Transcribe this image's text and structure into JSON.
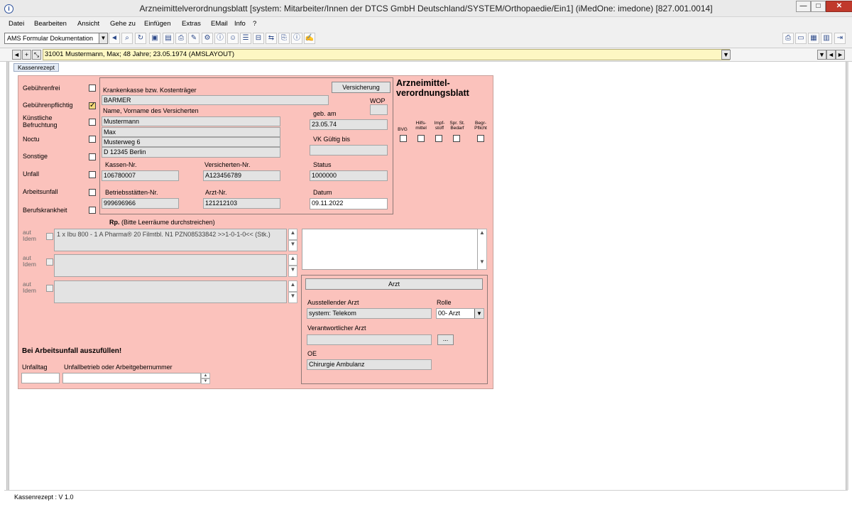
{
  "window": {
    "title": "Arzneimittelverordnungsblatt [system: Mitarbeiter/Innen der DTCS GmbH Deutschland/SYSTEM/Orthopaedie/Ein1] (iMedOne: imedone) [827.001.0014]",
    "minimize": "—",
    "maximize": "□",
    "close": "✕"
  },
  "menu": [
    "Datei",
    "Bearbeiten",
    "Ansicht",
    "Gehe zu",
    "Einfügen",
    "Extras",
    "EMail",
    "Info",
    "?"
  ],
  "toolbar": {
    "combo_value": "AMS Formular Dokumentation"
  },
  "patient": {
    "value": "31001 Mustermann, Max; 48 Jahre; 23.05.1974 (AMSLAYOUT)"
  },
  "tab": {
    "label": "Kassenrezept"
  },
  "left": {
    "items": [
      {
        "label": "Gebührenfrei",
        "checked": false
      },
      {
        "label": "Gebührenpflichtig",
        "checked": true
      },
      {
        "label": "Künstliche Befruchtung",
        "checked": false
      },
      {
        "label": "Noctu",
        "checked": false
      },
      {
        "label": "Sonstige",
        "checked": false
      },
      {
        "label": "Unfall",
        "checked": false
      },
      {
        "label": "Arbeitsunfall",
        "checked": false
      },
      {
        "label": "Berufskrankheit",
        "checked": false
      }
    ]
  },
  "insurance": {
    "kasse_label": "Krankenkasse bzw. Kostenträger",
    "kasse_value": "BARMER",
    "versicherung_button": "Versicherung",
    "wop_label": "WOP",
    "wop_value": "",
    "name_label": "Name, Vorname des Versicherten",
    "lastname": "Mustermann",
    "firstname": "Max",
    "street": "Musterweg 6",
    "city": "D 12345 Berlin",
    "geb_label": "geb. am",
    "geb_value": "23.05.74",
    "vk_label": "VK Gültig bis",
    "vk_value": "",
    "kassennr_label": "Kassen-Nr.",
    "kassennr_value": "106780007",
    "versnr_label": "Versicherten-Nr.",
    "versnr_value": "A123456789",
    "status_label": "Status",
    "status_value": "1000000",
    "bsnr_label": "Betriebsstätten-Nr.",
    "bsnr_value": "999696966",
    "arztnr_label": "Arzt-Nr.",
    "arztnr_value": "121212103",
    "datum_label": "Datum",
    "datum_value": "09.11.2022"
  },
  "heading": {
    "line1": "Arzneimittel-",
    "line2": "verordnungsblatt"
  },
  "flags": [
    {
      "label": "BVG",
      "checked": false
    },
    {
      "label": "Hilfs-\nmittel",
      "checked": false
    },
    {
      "label": "Impf-\nstoff",
      "checked": false
    },
    {
      "label": "Spr. St.\nBedarf",
      "checked": false
    },
    {
      "label": "Begr-\nPflicht",
      "checked": false
    }
  ],
  "rx": {
    "title_bold": "Rp.",
    "title_hint": "(Bitte Leerräume durchstreichen)",
    "aut_idem": "aut\nIdem",
    "lines": [
      "1 x Ibu 800 - 1 A Pharma® 20 Filmtbl. N1  PZN08533842 >>1-0-1-0<< (Stk.)",
      "",
      ""
    ]
  },
  "arzt": {
    "button": "Arzt",
    "aussteller_label": "Ausstellender Arzt",
    "aussteller_value": "system: Telekom",
    "rolle_label": "Rolle",
    "rolle_value": "00- Arzt",
    "verantwortlich_label": "Verantwortlicher Arzt",
    "verantwortlich_value": "",
    "dots": "...",
    "oe_label": "OE",
    "oe_value": "Chirurgie Ambulanz"
  },
  "accident": {
    "heading": "Bei Arbeitsunfall auszufüllen!",
    "tag_label": "Unfalltag",
    "tag_value": "",
    "betrieb_label": "Unfallbetrieb oder Arbeitgebernummer",
    "betrieb_value": ""
  },
  "status": {
    "text": "Kassenrezept : V 1.0"
  },
  "colors": {
    "form_bg": "#fbc2bc",
    "patient_bg": "#fdf7c3"
  }
}
